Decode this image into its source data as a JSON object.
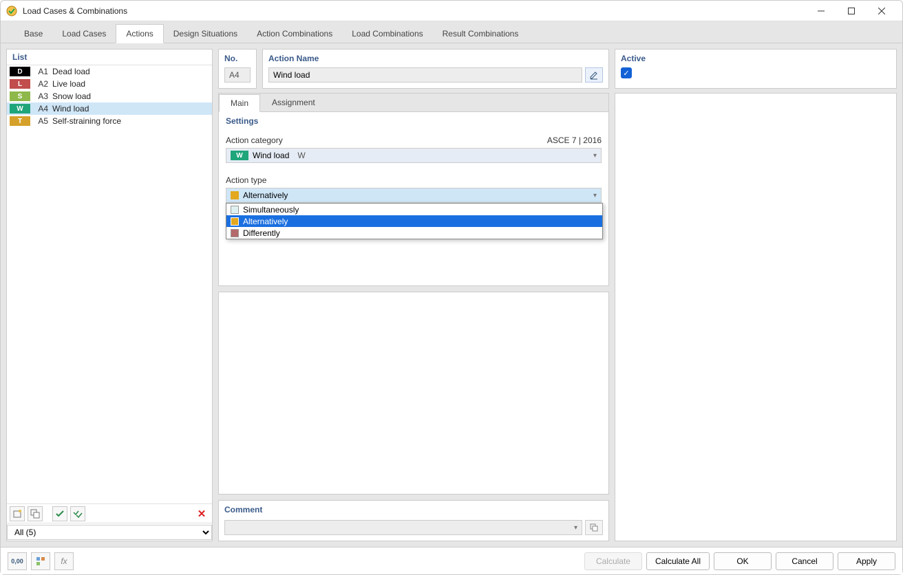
{
  "window": {
    "title": "Load Cases & Combinations"
  },
  "topTabs": [
    "Base",
    "Load Cases",
    "Actions",
    "Design Situations",
    "Action Combinations",
    "Load Combinations",
    "Result Combinations"
  ],
  "topTabActive": 2,
  "list": {
    "header": "List",
    "items": [
      {
        "tag": "D",
        "id": "A1",
        "name": "Dead load"
      },
      {
        "tag": "L",
        "id": "A2",
        "name": "Live load"
      },
      {
        "tag": "S",
        "id": "A3",
        "name": "Snow load"
      },
      {
        "tag": "W",
        "id": "A4",
        "name": "Wind load"
      },
      {
        "tag": "T",
        "id": "A5",
        "name": "Self-straining force"
      }
    ],
    "selectedIndex": 3,
    "filter": "All (5)"
  },
  "detail": {
    "noLabel": "No.",
    "noValue": "A4",
    "nameLabel": "Action Name",
    "nameValue": "Wind load",
    "activeLabel": "Active",
    "activeChecked": true
  },
  "innerTabs": [
    "Main",
    "Assignment"
  ],
  "innerTabActive": 0,
  "settings": {
    "header": "Settings",
    "categoryLabel": "Action category",
    "categoryStandard": "ASCE 7 | 2016",
    "categoryTag": "W",
    "categoryName": "Wind load",
    "categoryCode": "W",
    "typeLabel": "Action type",
    "typeSelected": "Alternatively",
    "typeSwatch": "#e3a81f",
    "typeOptions": [
      {
        "label": "Simultaneously",
        "color": "#dff0f0"
      },
      {
        "label": "Alternatively",
        "color": "#e3a81f"
      },
      {
        "label": "Differently",
        "color": "#b46a6a"
      }
    ],
    "typeHighlightedIndex": 1
  },
  "comment": {
    "label": "Comment",
    "value": ""
  },
  "footer": {
    "calculate": "Calculate",
    "calculateAll": "Calculate All",
    "ok": "OK",
    "cancel": "Cancel",
    "apply": "Apply"
  }
}
